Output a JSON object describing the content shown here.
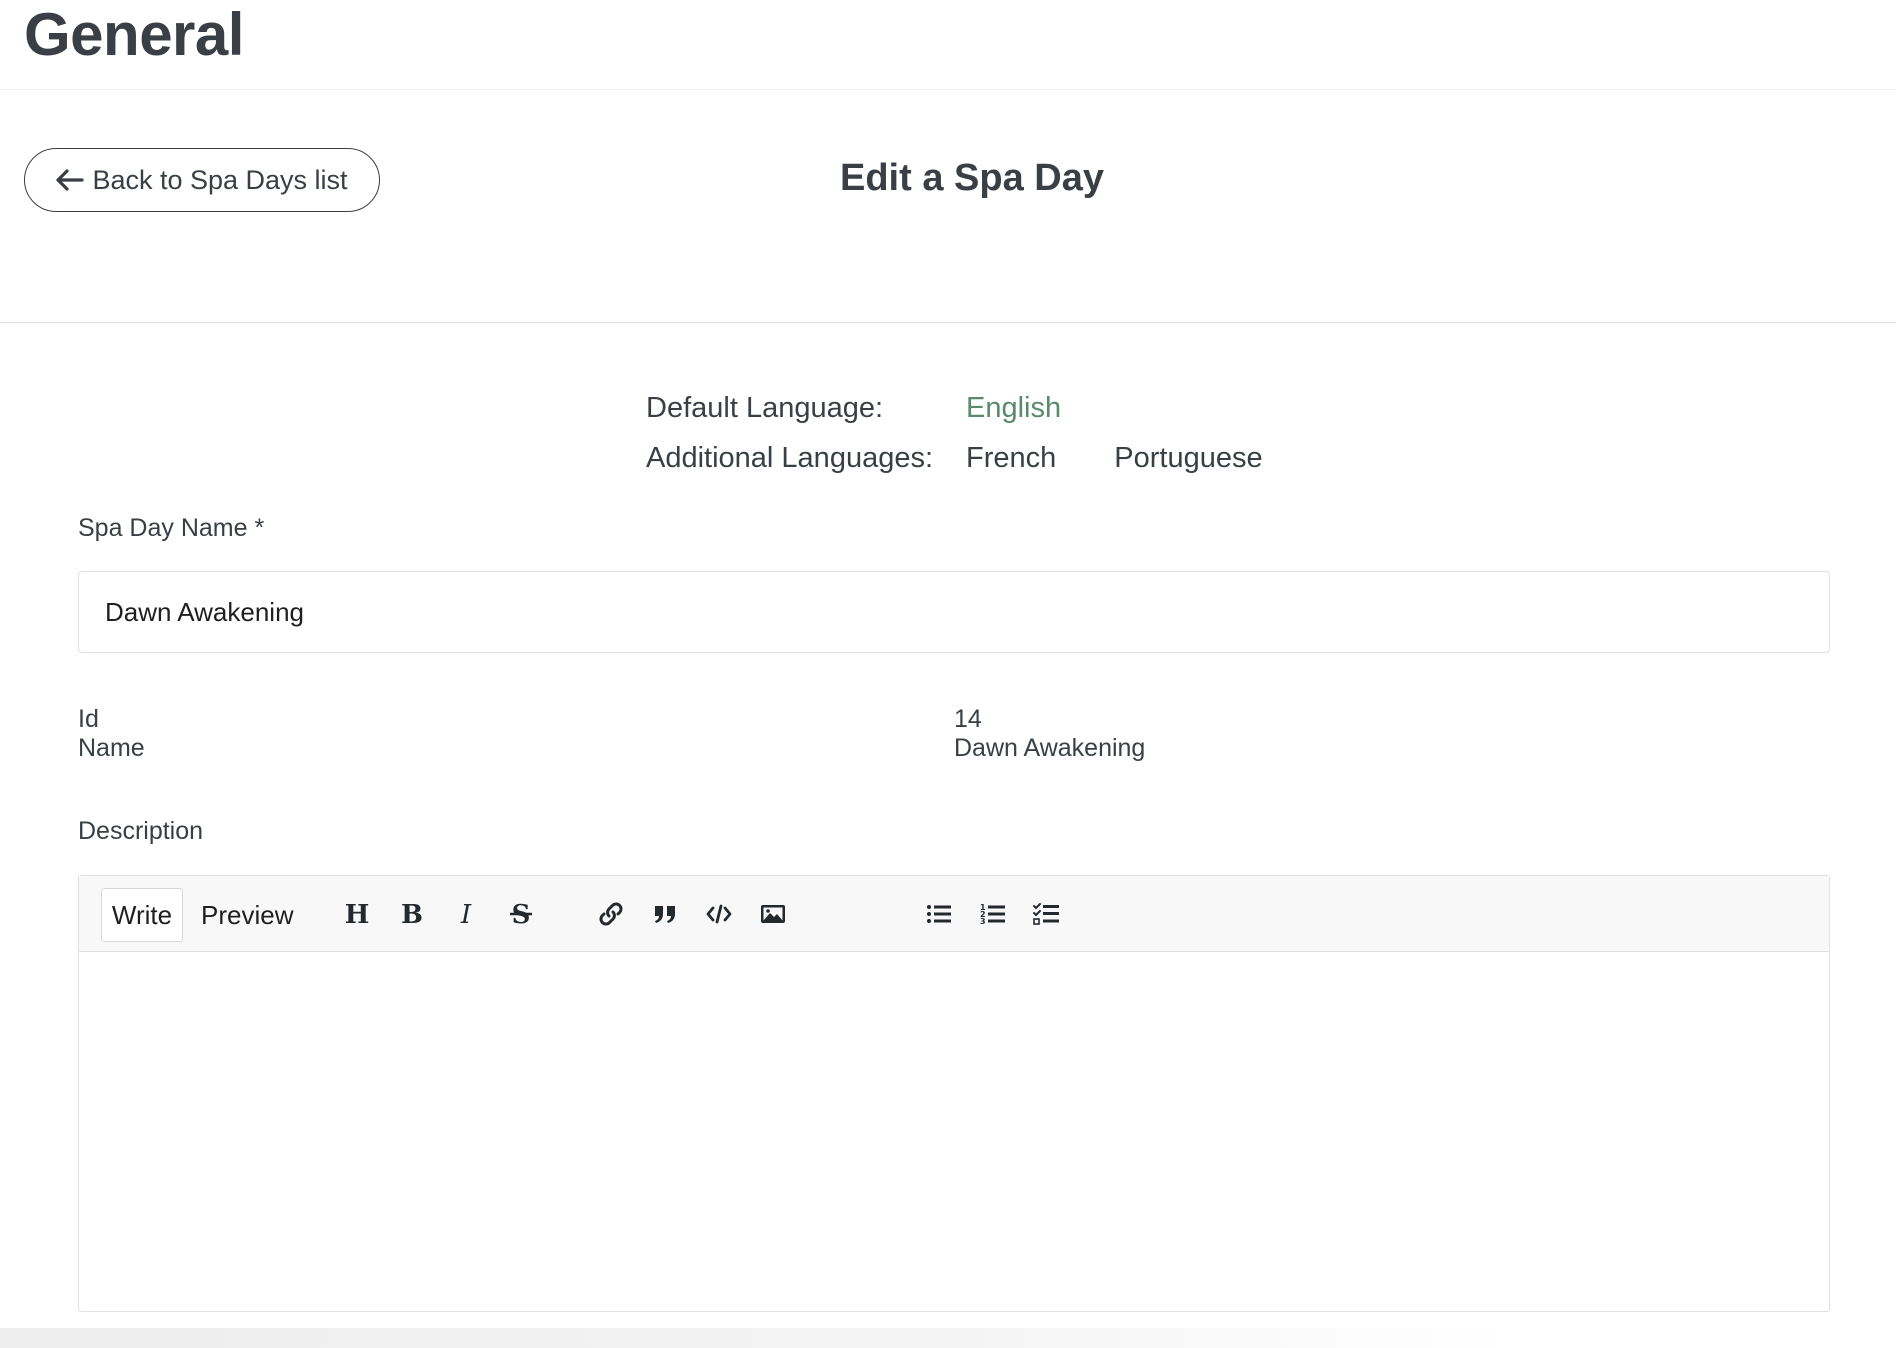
{
  "header": {
    "title": "General"
  },
  "title_bar": {
    "back_label": "Back to Spa Days list",
    "edit_title": "Edit a Spa Day"
  },
  "languages": {
    "default_label": "Default Language:",
    "default_value": "English",
    "additional_label": "Additional Languages:",
    "additional_values": [
      "French",
      "Portuguese"
    ]
  },
  "form": {
    "name_label": "Spa Day Name *",
    "name_value": "Dawn Awakening",
    "info": [
      {
        "key": "Id",
        "value": "14"
      },
      {
        "key": "Name",
        "value": "Dawn Awakening"
      }
    ],
    "description_label": "Description"
  },
  "editor": {
    "tabs": {
      "write": "Write",
      "preview": "Preview"
    },
    "tools": [
      "heading-icon",
      "bold-icon",
      "italic-icon",
      "strikethrough-icon",
      "link-icon",
      "quote-icon",
      "code-icon",
      "image-icon",
      "unordered-list-icon",
      "ordered-list-icon",
      "task-list-icon"
    ]
  },
  "colors": {
    "text": "#3a3f45",
    "accent_green": "#5a8a6c",
    "border": "#dfe1e4",
    "toolbar_bg": "#f8f8f8"
  }
}
